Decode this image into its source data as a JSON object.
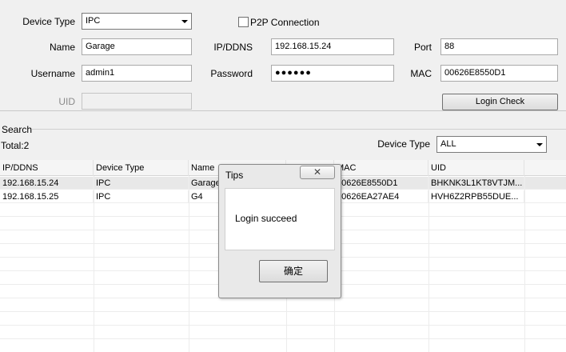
{
  "form": {
    "device_type_label": "Device Type",
    "device_type_value": "IPC",
    "p2p_label": "P2P Connection",
    "p2p_checked": false,
    "name_label": "Name",
    "name_value": "Garage",
    "ipddns_label": "IP/DDNS",
    "ipddns_value": "192.168.15.24",
    "port_label": "Port",
    "port_value": "88",
    "username_label": "Username",
    "username_value": "admin1",
    "password_label": "Password",
    "password_value": "●●●●●●",
    "mac_label": "MAC",
    "mac_value": "00626E8550D1",
    "uid_label": "UID",
    "uid_value": "",
    "login_check_label": "Login Check"
  },
  "search": {
    "label": "Search",
    "total_text": "Total:2",
    "device_type_label": "Device Type",
    "device_type_value": "ALL"
  },
  "table": {
    "headers": [
      "IP/DDNS",
      "Device Type",
      "Name",
      "",
      "MAC",
      "UID"
    ],
    "rows": [
      [
        "192.168.15.24",
        "IPC",
        "Garage",
        "",
        "00626E8550D1",
        "BHKNK3L1KT8VTJM..."
      ],
      [
        "192.168.15.25",
        "IPC",
        "G4",
        "",
        "00626EA27AE4",
        "HVH6Z2RPB55DUE..."
      ]
    ]
  },
  "dialog": {
    "title": "Tips",
    "close_glyph": "✕",
    "message": "Login succeed",
    "ok_label": "确定"
  }
}
